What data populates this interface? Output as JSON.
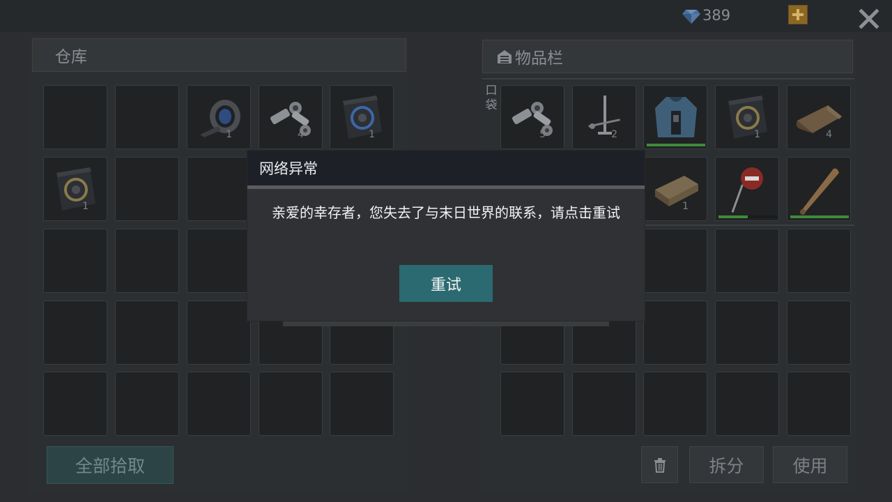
{
  "top_bar": {
    "gem_icon": "diamond-gem-icon",
    "gem_count": "389",
    "plus_icon": "plus-icon",
    "close_label": "X"
  },
  "warehouse": {
    "title": "仓库",
    "slots": [
      {
        "icon": null,
        "qty": ""
      },
      {
        "icon": null,
        "qty": ""
      },
      {
        "icon": "duct-tape-icon",
        "qty": "1"
      },
      {
        "icon": "nuts-bolts-icon",
        "qty": "4"
      },
      {
        "icon": "blue-book-icon",
        "qty": "1"
      },
      {
        "icon": "gold-book-icon",
        "qty": "1"
      }
    ],
    "pickup_all_label": "全部拾取"
  },
  "inventory": {
    "title": "物品栏",
    "pocket_label_1": "口",
    "pocket_label_2": "袋",
    "slots": [
      {
        "icon": "nuts-bolts-icon",
        "qty": "5"
      },
      {
        "icon": "nails-icon",
        "qty": "2"
      },
      {
        "icon": "hoodie-icon",
        "qty": "",
        "durability": 1.0
      },
      {
        "icon": "gold-book-icon",
        "qty": "1"
      },
      {
        "icon": "leather-scroll-icon",
        "qty": "4"
      },
      {
        "icon": "wood-plank-icon",
        "qty": "1"
      },
      {
        "icon": "stop-sign-icon",
        "qty": "",
        "durability": 0.5
      },
      {
        "icon": "baseball-bat-icon",
        "qty": "",
        "durability": 1.0
      }
    ],
    "trash_icon": "trash-icon",
    "split_label": "拆分",
    "use_label": "使用"
  },
  "dialog": {
    "title": "网络异常",
    "message": "亲爱的幸存者，您失去了与末日世界的联系，请点击重试",
    "retry_label": "重试"
  },
  "colors": {
    "accent_teal": "#2b6a70",
    "durability_green": "#3f8a3c",
    "plus_gold": "#8b6724"
  }
}
